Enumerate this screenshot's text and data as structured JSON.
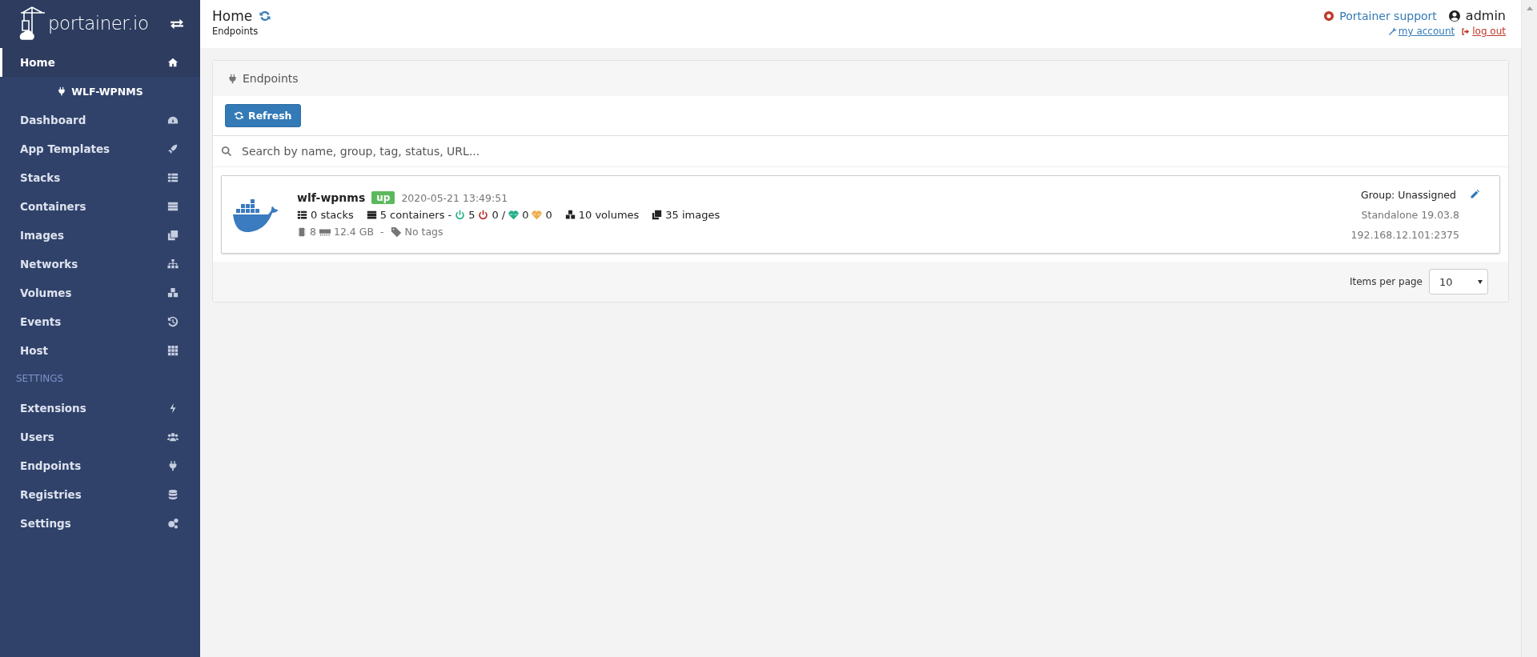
{
  "sidebar": {
    "logo": "portainer.io",
    "items": [
      {
        "label": "Home",
        "selected": true
      }
    ],
    "endpoint": "WLF-WPNMS",
    "endpoint_items": [
      {
        "label": "Dashboard",
        "selected": false
      },
      {
        "label": "App Templates",
        "selected": false
      },
      {
        "label": "Stacks",
        "selected": false
      },
      {
        "label": "Containers",
        "selected": false
      },
      {
        "label": "Images",
        "selected": false
      },
      {
        "label": "Networks",
        "selected": false
      },
      {
        "label": "Volumes",
        "selected": false
      },
      {
        "label": "Events",
        "selected": false
      },
      {
        "label": "Host",
        "selected": false
      }
    ],
    "section_title": "SETTINGS",
    "settings_items": [
      {
        "label": "Extensions",
        "selected": false
      },
      {
        "label": "Users",
        "selected": false
      },
      {
        "label": "Endpoints",
        "selected": false
      },
      {
        "label": "Registries",
        "selected": false
      },
      {
        "label": "Settings",
        "selected": false
      }
    ]
  },
  "header": {
    "title": "Home",
    "subtitle": "Endpoints",
    "support_link": "Portainer support",
    "user": "admin",
    "account_link": "my account",
    "logout_link": "log out"
  },
  "panel": {
    "title": "Endpoints",
    "refresh_button": "Refresh",
    "search": {
      "placeholder": "Search by name, group, tag, status, URL..."
    },
    "endpoints": [
      {
        "name": "wlf-wpnms",
        "status": "up",
        "date": "2020-05-21 13:49:51",
        "stacks": "0 stacks",
        "containers": "5 containers",
        "dash": "-",
        "running": "5",
        "stopped": "0",
        "slash": "/",
        "healthy": "0",
        "unhealthy": "0",
        "volumes": "10 volumes",
        "images": "35 images",
        "cpu": "8",
        "memory": "12.4 GB",
        "separator": "-",
        "tags": "No tags",
        "group": "Group: Unassigned",
        "type": "Standalone 19.03.8",
        "url": "192.168.12.101:2375"
      }
    ],
    "pagination": {
      "label": "Items per page",
      "value": "10"
    }
  }
}
